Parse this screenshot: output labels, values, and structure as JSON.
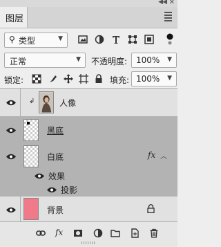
{
  "window": {
    "collapse_icon": "double-chevron-left-icon",
    "close_icon": "close-icon"
  },
  "tab": {
    "label": "图层"
  },
  "filter": {
    "kind_label": "类型",
    "icons": [
      "image-filter-icon",
      "adjustment-filter-icon",
      "type-filter-icon",
      "shape-filter-icon",
      "smart-object-filter-icon",
      "filter-toggle-icon"
    ]
  },
  "blend": {
    "mode": "正常",
    "opacity_label": "不透明度:",
    "opacity_value": "100%"
  },
  "lock": {
    "label": "锁定:",
    "icons": [
      "lock-transparent-pixels-icon",
      "lock-image-pixels-icon",
      "lock-position-icon",
      "lock-artboard-icon",
      "lock-all-icon"
    ],
    "fill_label": "填充:",
    "fill_value": "100%"
  },
  "layers": [
    {
      "name": "人像",
      "clipped": true,
      "selected": false,
      "thumb": "portrait"
    },
    {
      "name": "黑底",
      "selected": true,
      "underline": true,
      "thumb": "transparent-dot"
    },
    {
      "name": "白底",
      "selected": true,
      "fx": "fx",
      "thumb": "transparent",
      "effects_label": "效果",
      "effect_items": [
        "投影"
      ]
    },
    {
      "name": "背景",
      "selected": false,
      "locked": true,
      "thumb": "pink",
      "thumb_color": "#f07a8a"
    }
  ],
  "bottom": {
    "icons": [
      "link-layers-icon",
      "fx-icon",
      "add-mask-icon",
      "adjustment-layer-icon",
      "new-group-icon",
      "new-layer-icon",
      "delete-icon"
    ],
    "fx_label": "fx"
  }
}
